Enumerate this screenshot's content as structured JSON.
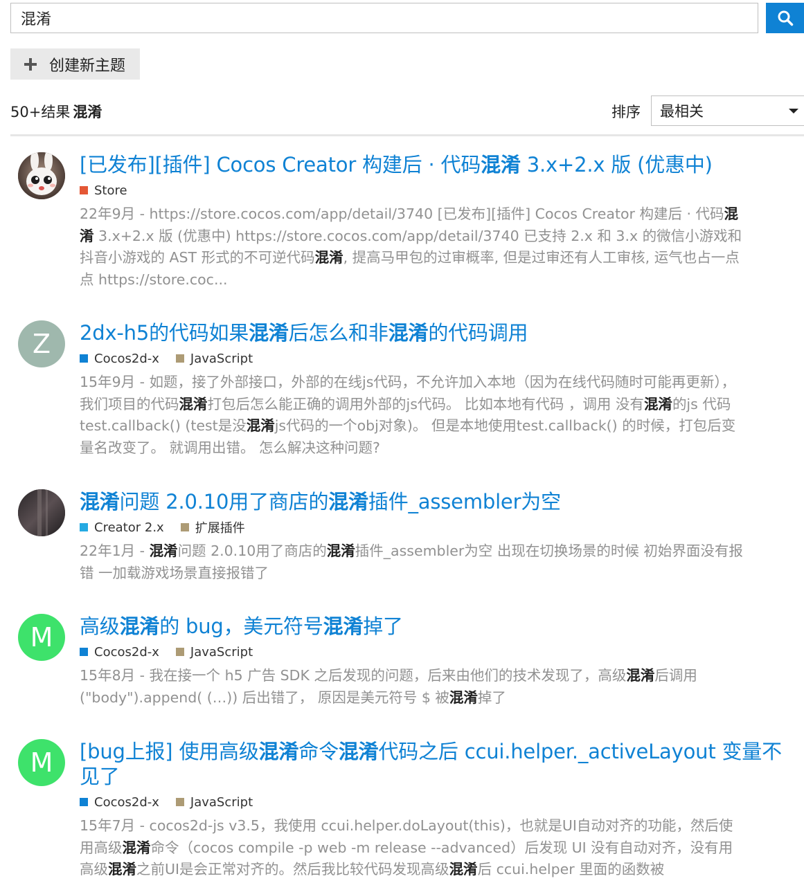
{
  "search": {
    "query": "混淆",
    "button_icon": "search-icon"
  },
  "new_topic": {
    "icon": "plus-icon",
    "label": "创建新主题"
  },
  "results_header": {
    "count": "50+结果",
    "term": "混淆",
    "sort_label": "排序",
    "sort_value": "最相关"
  },
  "colors": {
    "link": "#0f82d4",
    "muted": "#919191",
    "cat_store": "#e45735",
    "cat_cocos2dx": "#0f82d4",
    "cat_creator2x": "#25aae2",
    "cat_js": "#ad9b75"
  },
  "results": [
    {
      "avatar_letter": "",
      "avatar_color": "#6b5a52",
      "title": "[已发布][插件] Cocos Creator 构建后 · 代码混淆 3.x+2.x 版 (优惠中)",
      "categories": [
        {
          "name": "Store",
          "color": "#e45735"
        }
      ],
      "blurb": "22年9月 - https://store.cocos.com/app/detail/3740 [已发布][插件] Cocos Creator 构建后 · 代码混淆 3.x+2.x 版 (优惠中) https://store.cocos.com/app/detail/3740 已支持 2.x 和 3.x 的微信小游戏和抖音小游戏的 AST 形式的不可逆代码混淆, 提高马甲包的过审概率, 但是过审还有人工审核, 运气也占一点点 https://store.coc..."
    },
    {
      "avatar_letter": "Z",
      "avatar_color": "#9fb8ad",
      "title": "2dx-h5的代码如果混淆后怎么和非混淆的代码调用",
      "categories": [
        {
          "name": "Cocos2d-x",
          "color": "#0f82d4"
        },
        {
          "name": "JavaScript",
          "color": "#ad9b75"
        }
      ],
      "blurb": "15年9月 - 如题，接了外部接口，外部的在线js代码，不允许加入本地（因为在线代码随时可能再更新），我们项目的代码混淆打包后怎么能正确的调用外部的js代码。 比如本地有代码 ，调用 没有混淆的js 代码 test.callback() (test是没混淆js代码的一个obj对象)。 但是本地使用test.callback() 的时候，打包后变量名改变了。 就调用出错。 怎么解决这种问题?"
    },
    {
      "avatar_letter": "",
      "avatar_color": "#3a3538",
      "title": "混淆问题 2.0.10用了商店的混淆插件_assembler为空",
      "categories": [
        {
          "name": "Creator 2.x",
          "color": "#25aae2"
        },
        {
          "name": "扩展插件",
          "color": "#ad9b75"
        }
      ],
      "blurb": "22年1月 - 混淆问题 2.0.10用了商店的混淆插件_assembler为空 出现在切换场景的时候 初始界面没有报错 一加载游戏场景直接报错了"
    },
    {
      "avatar_letter": "M",
      "avatar_color": "#3ee26b",
      "title": "高级混淆的 bug，美元符号混淆掉了",
      "categories": [
        {
          "name": "Cocos2d-x",
          "color": "#0f82d4"
        },
        {
          "name": "JavaScript",
          "color": "#ad9b75"
        }
      ],
      "blurb": "15年8月 - 我在接一个 h5 广告 SDK 之后发现的问题，后来由他们的技术发现了，高级混淆后调用 (\"body\").append( (…)) 后出错了， 原因是美元符号 $ 被混淆掉了"
    },
    {
      "avatar_letter": "M",
      "avatar_color": "#3ee26b",
      "title": "[bug上报] 使用高级混淆命令混淆代码之后 ccui.helper._activeLayout 变量不见了",
      "categories": [
        {
          "name": "Cocos2d-x",
          "color": "#0f82d4"
        },
        {
          "name": "JavaScript",
          "color": "#ad9b75"
        }
      ],
      "blurb": "15年7月 - cocos2d-js v3.5，我使用 ccui.helper.doLayout(this)，也就是UI自动对齐的功能，然后使用高级混淆命令（cocos compile -p web -m release --advanced）后发现 UI 没有自动对齐，没有用高级混淆之前UI是会正常对齐的。然后我比较代码发现高级混淆后 ccui.helper 里面的函数被"
    }
  ]
}
